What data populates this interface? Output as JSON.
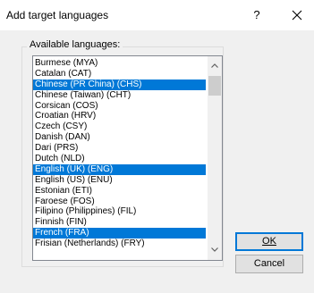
{
  "dialog": {
    "title": "Add target languages",
    "help_label": "?",
    "close_icon": "close-icon"
  },
  "group": {
    "label": "Available languages:"
  },
  "languages": [
    {
      "label": "Burmese (MYA)",
      "selected": false
    },
    {
      "label": "Catalan (CAT)",
      "selected": false
    },
    {
      "label": "Chinese (PR China) (CHS)",
      "selected": true
    },
    {
      "label": "Chinese (Taiwan) (CHT)",
      "selected": false
    },
    {
      "label": "Corsican (COS)",
      "selected": false
    },
    {
      "label": "Croatian (HRV)",
      "selected": false
    },
    {
      "label": "Czech (CSY)",
      "selected": false
    },
    {
      "label": "Danish (DAN)",
      "selected": false
    },
    {
      "label": "Dari (PRS)",
      "selected": false
    },
    {
      "label": "Dutch (NLD)",
      "selected": false
    },
    {
      "label": "English (UK) (ENG)",
      "selected": true
    },
    {
      "label": "English (US) (ENU)",
      "selected": false
    },
    {
      "label": "Estonian (ETI)",
      "selected": false
    },
    {
      "label": "Faroese (FOS)",
      "selected": false
    },
    {
      "label": "Filipino (Philippines) (FIL)",
      "selected": false
    },
    {
      "label": "Finnish (FIN)",
      "selected": false
    },
    {
      "label": "French (FRA)",
      "selected": true
    },
    {
      "label": "Frisian (Netherlands) (FRY)",
      "selected": false
    }
  ],
  "buttons": {
    "ok_label": "OK",
    "cancel_label": "Cancel"
  },
  "colors": {
    "selection": "#0078d7",
    "default_button_border": "#0078d7"
  }
}
